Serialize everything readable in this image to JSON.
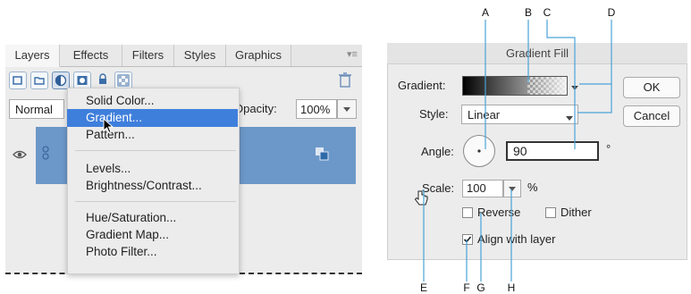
{
  "layers_panel": {
    "tabs": [
      "Layers",
      "Effects",
      "Filters",
      "Styles",
      "Graphics"
    ],
    "active_tab": "Layers",
    "blend_mode": "Normal",
    "opacity_label": "Opacity:",
    "opacity_value": "100%"
  },
  "adjustment_menu": {
    "items": [
      "Solid Color...",
      "Gradient...",
      "Pattern...",
      "Levels...",
      "Brightness/Contrast...",
      "Hue/Saturation...",
      "Gradient Map...",
      "Photo Filter..."
    ],
    "highlighted": "Gradient..."
  },
  "gradient_fill_dialog": {
    "title": "Gradient Fill",
    "gradient_label": "Gradient:",
    "style_label": "Style:",
    "style_value": "Linear",
    "angle_label": "Angle:",
    "angle_value": "90",
    "degree_symbol": "°",
    "scale_label": "Scale:",
    "scale_value": "100",
    "percent_symbol": "%",
    "reverse_label": "Reverse",
    "reverse_checked": false,
    "dither_label": "Dither",
    "dither_checked": false,
    "align_label": "Align with layer",
    "align_checked": true,
    "ok_label": "OK",
    "cancel_label": "Cancel"
  },
  "callouts": [
    "A",
    "B",
    "C",
    "D",
    "E",
    "F",
    "G",
    "H"
  ],
  "colors": {
    "selection_blue": "#3f7fdc",
    "layer_blue": "#6c98c9",
    "callout_line": "#4aa3d8"
  }
}
